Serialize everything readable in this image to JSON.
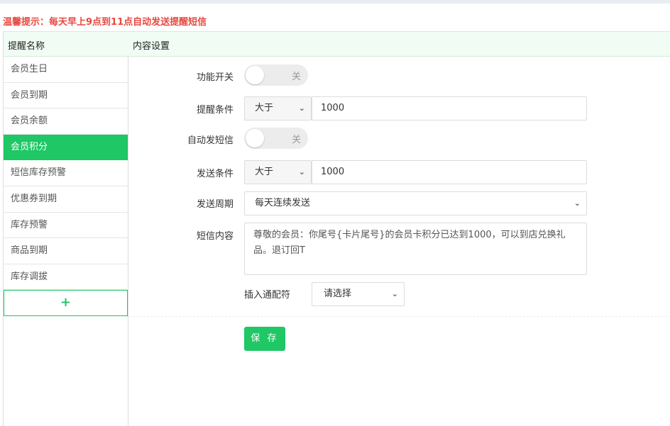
{
  "tip": "温馨提示：每天早上9点到11点自动发送提醒短信",
  "header": {
    "col_name": "提醒名称",
    "col_content": "内容设置"
  },
  "sidebar": {
    "items": [
      {
        "label": "会员生日"
      },
      {
        "label": "会员到期"
      },
      {
        "label": "会员余额"
      },
      {
        "label": "会员积分"
      },
      {
        "label": "短信库存预警"
      },
      {
        "label": "优惠券到期"
      },
      {
        "label": "库存预警"
      },
      {
        "label": "商品到期"
      },
      {
        "label": "库存调拔"
      }
    ],
    "active_index": 3,
    "add_label": "+"
  },
  "form": {
    "function_switch": {
      "label": "功能开关",
      "state": "关"
    },
    "reminder_condition": {
      "label": "提醒条件",
      "operator": "大于",
      "value": "1000"
    },
    "auto_sms": {
      "label": "自动发短信",
      "state": "关"
    },
    "send_condition": {
      "label": "发送条件",
      "operator": "大于",
      "value": "1000"
    },
    "send_cycle": {
      "label": "发送周期",
      "value": "每天连续发送"
    },
    "sms_content": {
      "label": "短信内容",
      "value": "尊敬的会员：你尾号{卡片尾号}的会员卡积分已达到1000，可以到店兑换礼品。退订回T"
    },
    "insert_placeholder": {
      "label": "插入通配符",
      "value": "请选择"
    },
    "save_label": "保 存"
  },
  "colors": {
    "accent": "#1fc765",
    "tip": "#e8483f",
    "header_bg": "#f0fcf4"
  }
}
